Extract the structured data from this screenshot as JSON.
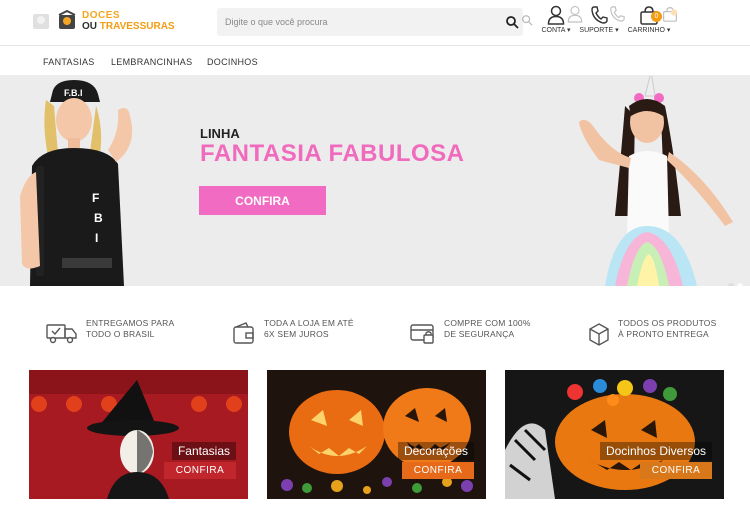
{
  "header": {
    "logo": {
      "line1": "DOCES",
      "line2a": "OU",
      "line2b": "TRAVESSURAS"
    },
    "search": {
      "placeholder": "Digite o que você procura"
    },
    "account_label": "CONTA",
    "support_label": "SUPORTE",
    "cart_label": "CARRINHO",
    "cart_count": "0"
  },
  "nav": {
    "items": [
      "FANTASIAS",
      "LEMBRANCINHAS",
      "DOCINHOS"
    ]
  },
  "hero": {
    "kicker": "LINHA",
    "title": "FANTASIA FABULOSA",
    "cta": "CONFIRA"
  },
  "features": [
    {
      "icon": "delivery-truck-icon",
      "line1": "ENTREGAMOS PARA",
      "line2": "TODO O BRASIL"
    },
    {
      "icon": "wallet-icon",
      "line1": "TODA A LOJA EM ATÉ",
      "line2": "6X SEM JUROS"
    },
    {
      "icon": "secure-card-icon",
      "line1": "COMPRE COM 100%",
      "line2": "DE SEGURANÇA"
    },
    {
      "icon": "box-icon",
      "line1": "TODOS OS PRODUTOS",
      "line2": "À PRONTO ENTREGA"
    }
  ],
  "cards": [
    {
      "name": "Fantasias",
      "cta": "CONFIRA",
      "button_color": "#c0262c"
    },
    {
      "name": "Decorações",
      "cta": "CONFIRA",
      "button_color": "#e66a1a"
    },
    {
      "name": "Docinhos Diversos",
      "cta": "CONFIRA",
      "button_color": "#d9781a"
    }
  ],
  "colors": {
    "brand_pink": "#f26bc2",
    "brand_orange": "#f39c12"
  }
}
